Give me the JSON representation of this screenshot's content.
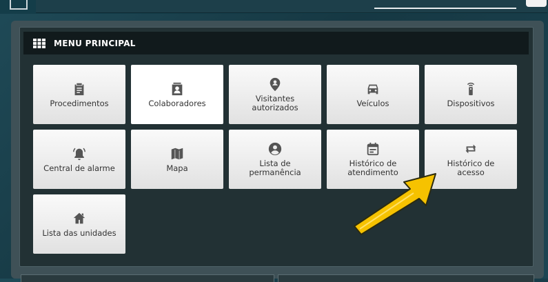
{
  "panel": {
    "title": "MENU PRINCIPAL",
    "title_icon": "grid-icon"
  },
  "tiles": [
    {
      "label": "Procedimentos",
      "icon": "clipboard-icon"
    },
    {
      "label": "Colaboradores",
      "icon": "badge-icon"
    },
    {
      "label": "Visitantes autorizados",
      "icon": "location-person-icon"
    },
    {
      "label": "Veículos",
      "icon": "car-icon"
    },
    {
      "label": "Dispositivos",
      "icon": "remote-control-icon"
    },
    {
      "label": "Central de alarme",
      "icon": "alarm-bell-icon"
    },
    {
      "label": "Mapa",
      "icon": "map-icon"
    },
    {
      "label": "Lista de permanência",
      "icon": "account-circle-icon"
    },
    {
      "label": "Histórico de atendimento",
      "icon": "calendar-icon"
    },
    {
      "label": "Histórico de acesso",
      "icon": "swap-arrows-icon"
    },
    {
      "label": "Lista das unidades",
      "icon": "home-icon"
    }
  ],
  "colors": {
    "icon": "#555555",
    "arrow": "#f6c200",
    "panel_bg": "#223134",
    "header_bg": "#111a1c"
  }
}
